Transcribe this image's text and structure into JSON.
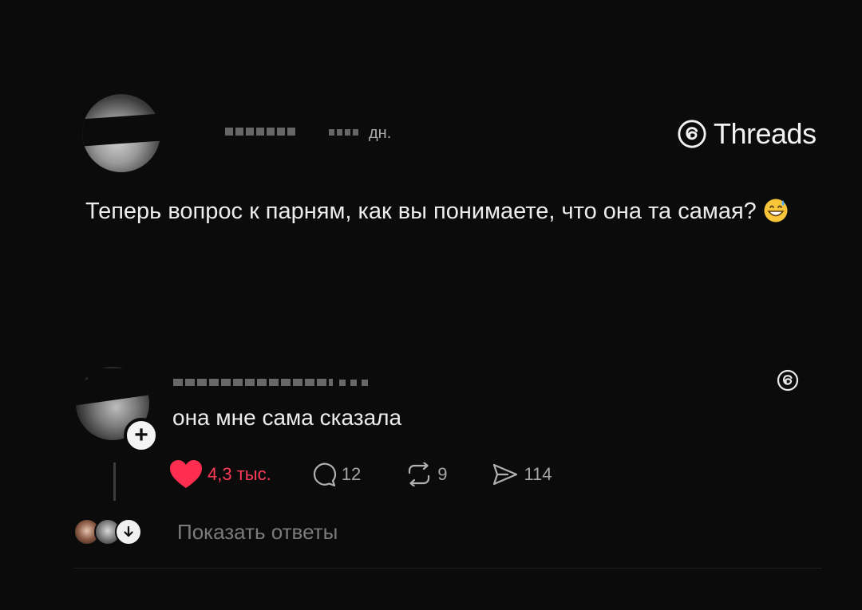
{
  "post": {
    "time": "дн.",
    "brand": "Threads",
    "text": "Теперь вопрос к парням, как вы понимаете, что она та самая?",
    "emoji": "grinning-sweat-emoji"
  },
  "reply": {
    "text": "она мне сама сказала",
    "follow_symbol": "+",
    "stats": {
      "likes": "4,3 тыс.",
      "comments": "12",
      "reposts": "9",
      "shares": "114"
    },
    "show_replies_label": "Показать ответы"
  },
  "colors": {
    "background": "#0b0b0c",
    "text": "#ececec",
    "muted": "#7b7b7b",
    "like": "#ff3b57"
  },
  "icons": [
    "threads-logo-icon",
    "heart-icon",
    "comment-icon",
    "repost-icon",
    "share-icon",
    "arrow-down-icon",
    "plus-icon"
  ]
}
